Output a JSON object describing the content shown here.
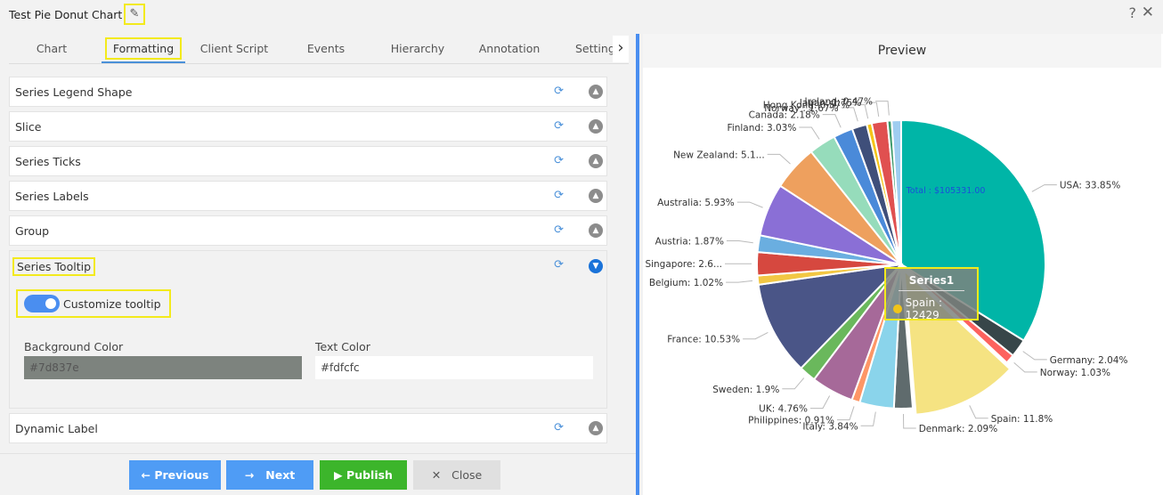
{
  "window": {
    "title": "Test Pie Donut Chart",
    "edit_icon": "pencil-square-icon",
    "help": "?",
    "close": "✕"
  },
  "tabs": [
    {
      "label": "Chart"
    },
    {
      "label": "Formatting",
      "active": true
    },
    {
      "label": "Client Script"
    },
    {
      "label": "Events"
    },
    {
      "label": "Hierarchy"
    },
    {
      "label": "Annotation"
    },
    {
      "label": "Setting"
    }
  ],
  "sections": [
    {
      "label": "Series Legend Shape"
    },
    {
      "label": "Slice"
    },
    {
      "label": "Series Ticks"
    },
    {
      "label": "Series Labels"
    },
    {
      "label": "Group"
    }
  ],
  "tooltip_section": {
    "label": "Series Tooltip",
    "toggle_label": "Customize tooltip",
    "toggle_on": true,
    "bg_label": "Background Color",
    "bg_value": "#7d837e",
    "text_label": "Text Color",
    "text_value": "#fdfcfc"
  },
  "dynamic_label": {
    "label": "Dynamic Label"
  },
  "footer": {
    "previous": "Previous",
    "next": "Next",
    "publish": "Publish",
    "close": "Close"
  },
  "preview": {
    "title": "Preview",
    "total_label": "Total : $105331.00",
    "tooltip": {
      "title": "Series1",
      "text": "Spain : 12429"
    }
  },
  "colors": {
    "accent": "#4a8ef0",
    "publish": "#3cb52b",
    "highlight": "#f3ea1c"
  },
  "chart_data": {
    "type": "pie",
    "series_name": "Series1",
    "slices": [
      {
        "label": "USA: 33.85%",
        "value": 33.85,
        "color": "#00b5a7"
      },
      {
        "label": "Germany: 2.04%",
        "value": 2.04,
        "color": "#374649"
      },
      {
        "label": "Norway: 1.03%",
        "value": 1.03,
        "color": "#fd625e"
      },
      {
        "label": "Spain: 11.8%",
        "value": 11.8,
        "color": "#f5e382",
        "exploded": true
      },
      {
        "label": "Denmark: 2.09%",
        "value": 2.09,
        "color": "#5f6b6d"
      },
      {
        "label": "Italy: 3.84%",
        "value": 3.84,
        "color": "#8ad4eb"
      },
      {
        "label": "Philippines: 0.91%",
        "value": 0.91,
        "color": "#fe9666"
      },
      {
        "label": "UK: 4.76%",
        "value": 4.76,
        "color": "#a66999"
      },
      {
        "label": "Sweden: 1.9%",
        "value": 1.9,
        "color": "#6ab85c"
      },
      {
        "label": "France: 10.53%",
        "value": 10.53,
        "color": "#4a5587"
      },
      {
        "label": "Belgium: 1.02%",
        "value": 1.02,
        "color": "#f2c744"
      },
      {
        "label": "Singapore: 2.6...",
        "value": 2.6,
        "color": "#d6483f"
      },
      {
        "label": "Austria: 1.87%",
        "value": 1.87,
        "color": "#6aaee0"
      },
      {
        "label": "Australia: 5.93%",
        "value": 5.93,
        "color": "#8a6fd6"
      },
      {
        "label": "New Zealand: 5.1...",
        "value": 5.1,
        "color": "#eea05e"
      },
      {
        "label": "Finland: 3.03%",
        "value": 3.03,
        "color": "#96dcbb"
      },
      {
        "label": "Canada: 2.18%",
        "value": 2.18,
        "color": "#4a8ad9"
      },
      {
        "label": "Norway : 1.67%",
        "value": 1.67,
        "color": "#3f4f7a"
      },
      {
        "label": "Hong Kong: 0.57%",
        "value": 0.57,
        "color": "#f5c518"
      },
      {
        "label": "Japan: 1.75%",
        "value": 1.75,
        "color": "#e05050"
      },
      {
        "label": "Ireland: 0.47%",
        "value": 0.47,
        "color": "#3a9a6a"
      },
      {
        "label": "",
        "value": 1.06,
        "color": "#9fcdf0"
      }
    ]
  }
}
